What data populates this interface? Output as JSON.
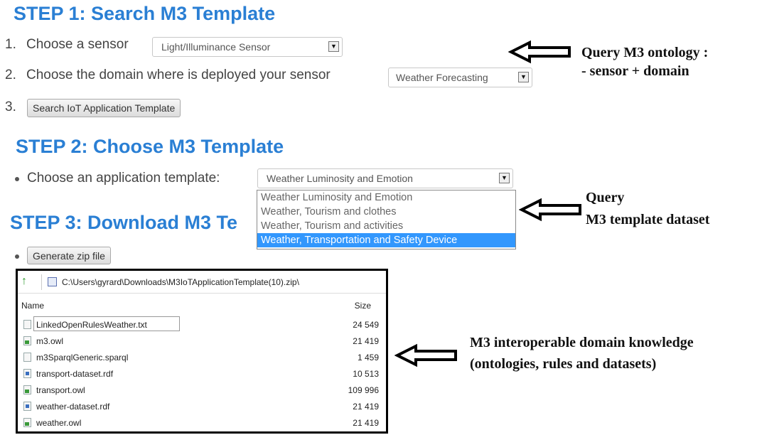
{
  "step1": {
    "heading": "STEP 1: Search M3 Template",
    "item1_number": "1.",
    "item1_label": "Choose a sensor",
    "sensor_value": "Light/Illuminance Sensor",
    "item2_number": "2.",
    "item2_label": "Choose the domain where is deployed your sensor",
    "domain_value": "Weather Forecasting",
    "item3_number": "3.",
    "search_button": "Search IoT Application Template"
  },
  "step2": {
    "heading": "STEP 2: Choose M3 Template",
    "label": "Choose an application template:",
    "selected_value": "Weather Luminosity and Emotion",
    "options": [
      "Weather Luminosity and Emotion",
      "Weather, Tourism and clothes",
      "Weather, Tourism and activities",
      "Weather, Transportation and Safety Device"
    ]
  },
  "step3": {
    "heading": "STEP 3: Download M3 Te",
    "generate_button": "Generate zip file"
  },
  "explorer": {
    "path": "C:\\Users\\gyrard\\Downloads\\M3IoTApplicationTemplate(10).zip\\",
    "col_name": "Name",
    "col_size": "Size",
    "files": [
      {
        "name": "LinkedOpenRulesWeather.txt",
        "size": "24 549",
        "icon": "text-file-icon"
      },
      {
        "name": "m3.owl",
        "size": "21 419",
        "icon": "owl-file-icon"
      },
      {
        "name": "m3SparqlGeneric.sparql",
        "size": "1 459",
        "icon": "text-file-icon"
      },
      {
        "name": "transport-dataset.rdf",
        "size": "10 513",
        "icon": "rdf-file-icon"
      },
      {
        "name": "transport.owl",
        "size": "109 996",
        "icon": "owl-file-icon"
      },
      {
        "name": "weather-dataset.rdf",
        "size": "21 419",
        "icon": "rdf-file-icon"
      },
      {
        "name": "weather.owl",
        "size": "21 419",
        "icon": "owl-file-icon"
      }
    ]
  },
  "annotations": {
    "a1_line1": "Query M3 ontology :",
    "a1_line2": "- sensor + domain",
    "a2_line1": "Query",
    "a2_line2": "M3 template dataset",
    "a3_line1": "M3 interoperable domain knowledge",
    "a3_line2": "(ontologies, rules and datasets)"
  },
  "colors": {
    "heading": "#2a7fd4",
    "selection": "#3297fd"
  }
}
